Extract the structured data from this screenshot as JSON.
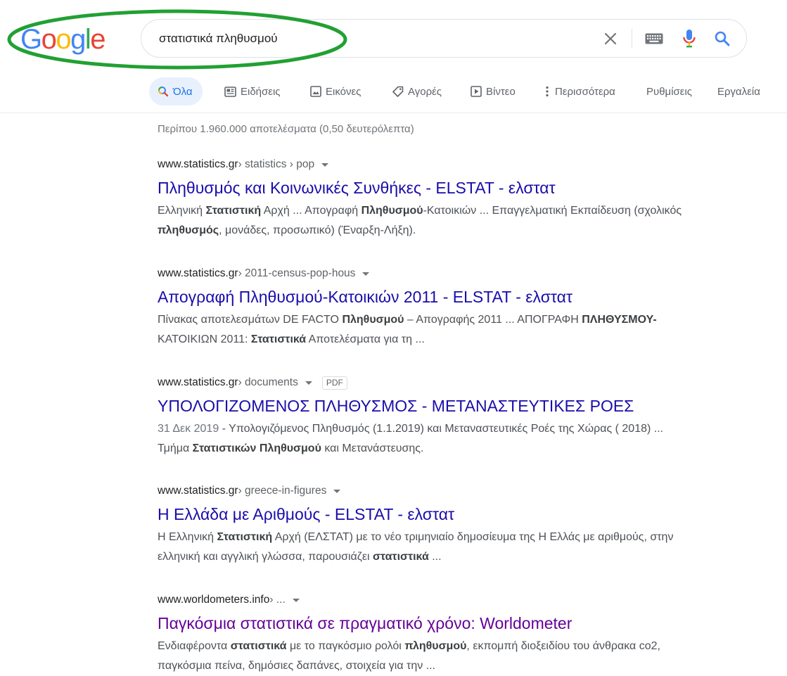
{
  "search": {
    "query": "στατιστικά πληθυσμού",
    "logo_letters": [
      {
        "ch": "G",
        "color": "#4285F4"
      },
      {
        "ch": "o",
        "color": "#EA4335"
      },
      {
        "ch": "o",
        "color": "#FBBC05"
      },
      {
        "ch": "g",
        "color": "#4285F4"
      },
      {
        "ch": "l",
        "color": "#34A853"
      },
      {
        "ch": "e",
        "color": "#EA4335"
      }
    ],
    "icons": [
      "close-icon",
      "keyboard-icon",
      "mic-icon",
      "search-icon"
    ],
    "highlight_color": "#22a033"
  },
  "tabs": {
    "all": "Όλα",
    "news": "Ειδήσεις",
    "images": "Εικόνες",
    "shopping": "Αγορές",
    "videos": "Βίντεο",
    "more": "Περισσότερα",
    "settings": "Ρυθμίσεις",
    "tools": "Εργαλεία"
  },
  "result_stats": "Περίπου 1.960.000 αποτελέσματα (0,50 δευτερόλεπτα)",
  "results": [
    {
      "domain": "www.statistics.gr",
      "path": " › statistics › pop",
      "title": "Πληθυσμός και Κοινωνικές Συνθήκες - ELSTAT - ελστατ",
      "snippet": [
        {
          "t": "Ελληνική ",
          "b": false
        },
        {
          "t": "Στατιστική",
          "b": true
        },
        {
          "t": " Αρχή ... Απογραφή ",
          "b": false
        },
        {
          "t": "Πληθυσμού",
          "b": true
        },
        {
          "t": "-Κατοικιών ... Επαγγελματική Εκπαίδευση (σχολικός ",
          "b": false
        },
        {
          "t": "πληθυσμός",
          "b": true
        },
        {
          "t": ", μονάδες, προσωπικό) (Έναρξη-Λήξη).",
          "b": false
        }
      ]
    },
    {
      "domain": "www.statistics.gr",
      "path": " › 2011-census-pop-hous",
      "title": "Απογραφή Πληθυσμού-Κατοικιών 2011 - ELSTAT - ελστατ",
      "snippet": [
        {
          "t": "Πίνακας αποτελεσμάτων DE FACTO ",
          "b": false
        },
        {
          "t": "Πληθυσμού",
          "b": true
        },
        {
          "t": " – Απογραφής 2011 ... ΑΠΟΓΡΑΦΗ ",
          "b": false
        },
        {
          "t": "ΠΛΗΘΥΣΜΟΥ-",
          "b": true
        },
        {
          "t": " ΚΑΤΟΙΚΙΩΝ 2011: ",
          "b": false
        },
        {
          "t": "Στατιστικά",
          "b": true
        },
        {
          "t": " Αποτελέσματα για τη ...",
          "b": false
        }
      ]
    },
    {
      "domain": "www.statistics.gr",
      "path": " › documents",
      "badge": "PDF",
      "title": "ΥΠΟΛΟΓΙΖΟΜΕΝΟΣ ΠΛΗΘΥΣΜΟΣ - ΜΕΤΑΝΑΣΤΕΥΤΙΚΕΣ ΡΟΕΣ",
      "date": "31 Δεκ 2019",
      "snippet": [
        {
          "t": " - Υπολογιζόμενος Πληθυσμός (1.1.2019) και Μεταναστευτικές Ροές της Χώρας ( 2018) ... Τμήμα ",
          "b": false
        },
        {
          "t": "Στατιστικών Πληθυσμού",
          "b": true
        },
        {
          "t": " και Μετανάστευσης.",
          "b": false
        }
      ]
    },
    {
      "domain": "www.statistics.gr",
      "path": " › greece-in-figures",
      "title": "Η Ελλάδα με Αριθμούς - ELSTAT - ελστατ",
      "snippet": [
        {
          "t": "Η Ελληνική ",
          "b": false
        },
        {
          "t": "Στατιστική",
          "b": true
        },
        {
          "t": " Αρχή (ΕΛΣΤΑΤ) με το νέο τριμηνιαίο δημοσίευμα της Η Ελλάς με αριθμούς, στην ελληνική και αγγλική γλώσσα, παρουσιάζει ",
          "b": false
        },
        {
          "t": "στατιστικά",
          "b": true
        },
        {
          "t": " ...",
          "b": false
        }
      ]
    },
    {
      "domain": "www.worldometers.info",
      "path": " › ...",
      "title": "Παγκόσμια στατιστικά σε πραγματικό χρόνο: Worldometer",
      "visited": true,
      "snippet": [
        {
          "t": "Ενδιαφέροντα ",
          "b": false
        },
        {
          "t": "στατιστικά",
          "b": true
        },
        {
          "t": " με το παγκόσμιο ρολόι ",
          "b": false
        },
        {
          "t": "πληθυσμού",
          "b": true
        },
        {
          "t": ", εκπομπή διοξειδίου του άνθρακα co2, παγκόσμια πείνα, δημόσιες δαπάνες, στοιχεία για την ...",
          "b": false
        }
      ]
    }
  ]
}
